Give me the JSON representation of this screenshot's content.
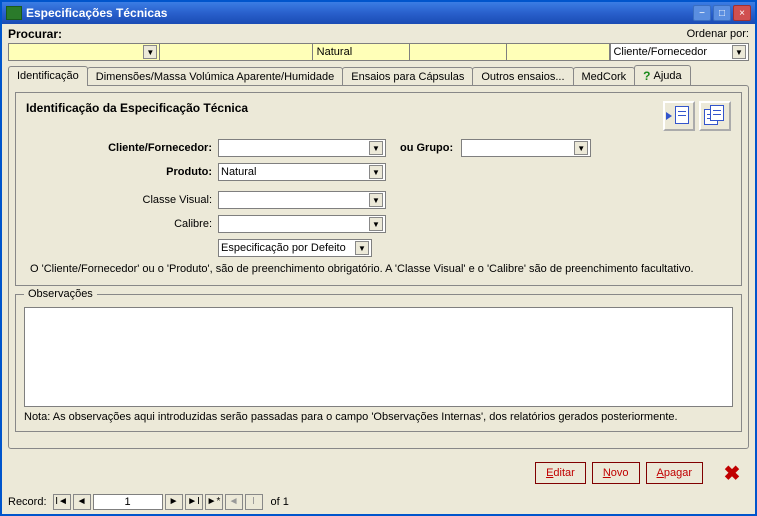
{
  "window": {
    "title": "Especificações Técnicas"
  },
  "search": {
    "label": "Procurar:",
    "yellow_mid": "Natural",
    "order_label": "Ordenar por:",
    "order_value": "Cliente/Fornecedor"
  },
  "tabs": {
    "t0": "Identificação",
    "t1": "Dimensões/Massa Volúmica Aparente/Humidade",
    "t2": "Ensaios para Cápsulas",
    "t3": "Outros ensaios...",
    "t4": "MedCork",
    "t5": "Ajuda"
  },
  "ident": {
    "title": "Identificação da Especificação Técnica",
    "cliente_label": "Cliente/Fornecedor:",
    "grupo_label": "ou Grupo:",
    "produto_label": "Produto:",
    "produto_value": "Natural",
    "classe_label": "Classe Visual:",
    "calibre_label": "Calibre:",
    "defeito_value": "Especificação por Defeito",
    "hint": "O 'Cliente/Fornecedor' ou o 'Produto', são de preenchimento obrigatório. A 'Classe Visual' e o 'Calibre' são de preenchimento facultativo."
  },
  "obs": {
    "legend": "Observações",
    "note": "Nota: As observações aqui introduzidas serão passadas para o campo 'Observações Internas', dos relatórios gerados posteriormente."
  },
  "buttons": {
    "editar": "ditar",
    "editar_u": "E",
    "novo": "ovo",
    "novo_u": "N",
    "apagar": "pagar",
    "apagar_u": "A"
  },
  "record": {
    "label": "Record:",
    "num": "1",
    "of": "of  1"
  }
}
